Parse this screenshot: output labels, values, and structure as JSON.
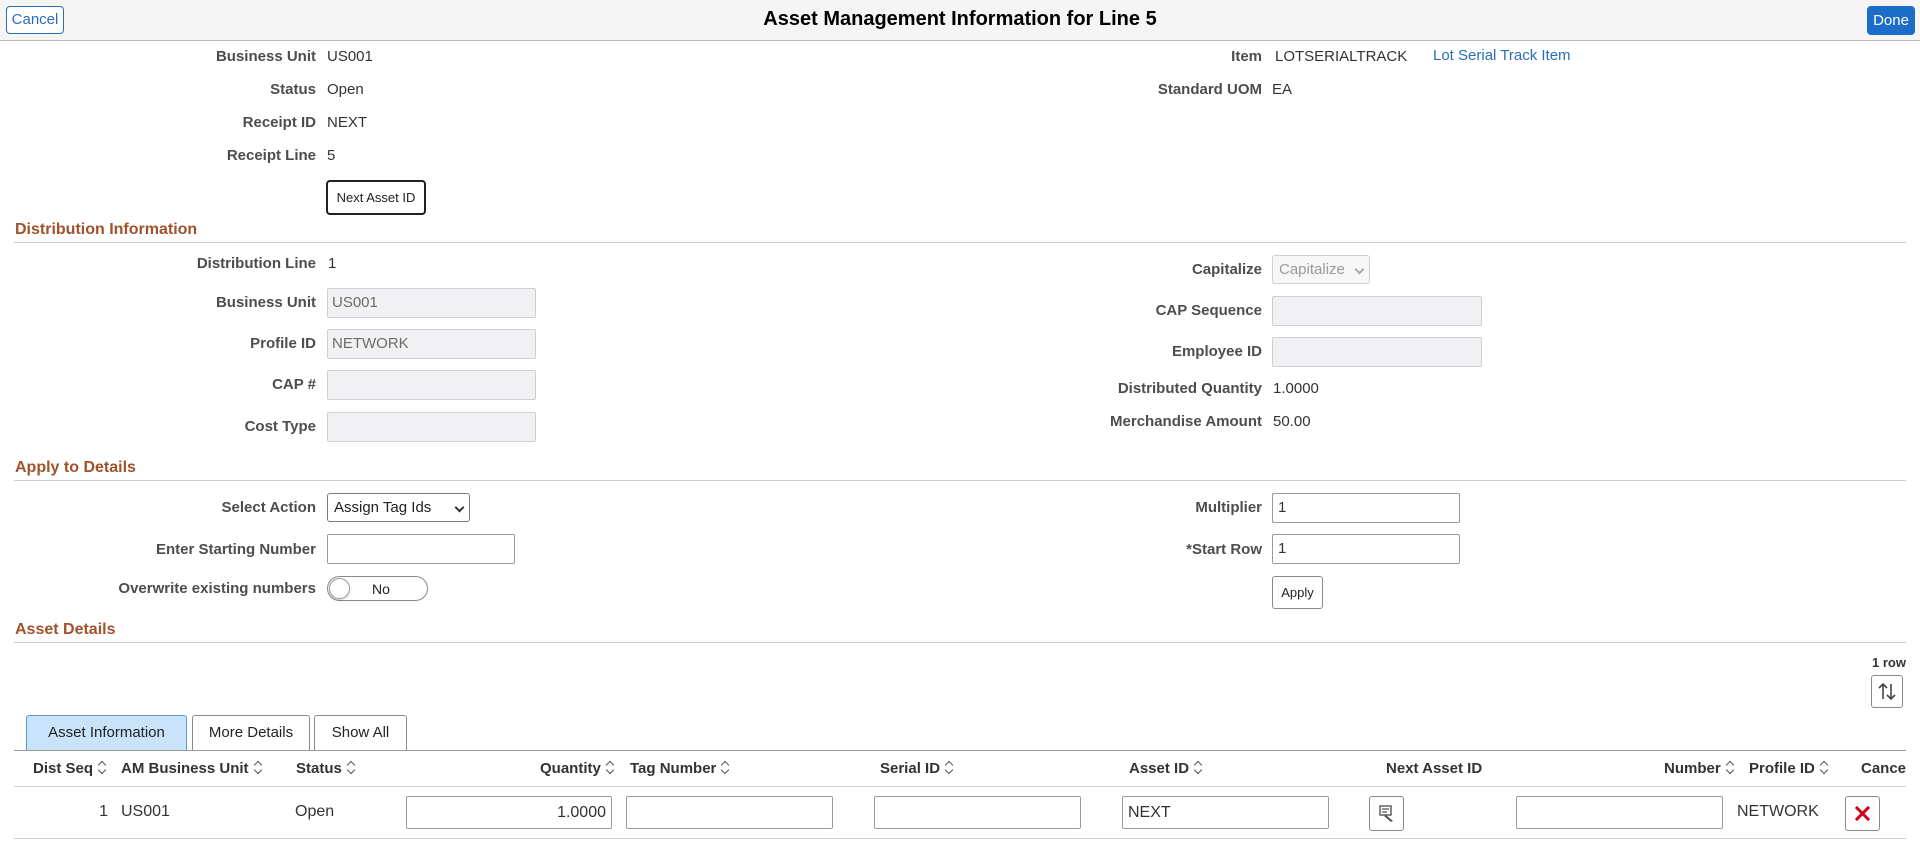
{
  "header": {
    "title": "Asset Management Information for Line 5",
    "cancel_label": "Cancel",
    "done_label": "Done"
  },
  "summary": {
    "business_unit_label": "Business Unit",
    "business_unit": "US001",
    "status_label": "Status",
    "status": "Open",
    "receipt_id_label": "Receipt ID",
    "receipt_id": "NEXT",
    "receipt_line_label": "Receipt Line",
    "receipt_line": "5",
    "item_label": "Item",
    "item": "LOTSERIALTRACK",
    "item_desc": "Lot Serial Track Item",
    "uom_label": "Standard UOM",
    "uom": "EA",
    "next_asset_button": "Next Asset ID"
  },
  "distribution": {
    "section_title": "Distribution Information",
    "line_label": "Distribution Line",
    "line": "1",
    "bu_label": "Business Unit",
    "bu": "US001",
    "profile_label": "Profile ID",
    "profile": "NETWORK",
    "cap_label": "CAP #",
    "cap": "",
    "cost_type_label": "Cost Type",
    "cost_type": "",
    "capitalize_label": "Capitalize",
    "capitalize": "Capitalize",
    "cap_seq_label": "CAP Sequence",
    "cap_seq": "",
    "employee_label": "Employee ID",
    "employee": "",
    "dist_qty_label": "Distributed Quantity",
    "dist_qty": "1.0000",
    "merch_label": "Merchandise Amount",
    "merch": "50.00"
  },
  "apply": {
    "section_title": "Apply to Details",
    "action_label": "Select Action",
    "action": "Assign Tag Ids",
    "start_num_label": "Enter Starting Number",
    "start_num": "",
    "overwrite_label": "Overwrite existing numbers",
    "overwrite": "No",
    "multiplier_label": "Multiplier",
    "multiplier": "1",
    "start_row_label": "*Start Row",
    "start_row": "1",
    "apply_button": "Apply"
  },
  "details": {
    "section_title": "Asset Details",
    "row_count": "1 row",
    "tabs": [
      "Asset Information",
      "More Details",
      "Show All"
    ],
    "columns": [
      "Dist Seq",
      "AM Business Unit",
      "Status",
      "Quantity",
      "Tag Number",
      "Serial ID",
      "Asset ID",
      "Next Asset ID",
      "Number",
      "Profile ID",
      "Cance"
    ],
    "row": {
      "dist_seq": "1",
      "am_bu": "US001",
      "status": "Open",
      "quantity": "1.0000",
      "tag_number": "",
      "serial_id": "",
      "asset_id": "NEXT",
      "number": "",
      "profile_id": "NETWORK"
    }
  },
  "colors": {
    "accent": "#1c6dc7",
    "section": "#a0522d",
    "delete": "#d0021b"
  }
}
